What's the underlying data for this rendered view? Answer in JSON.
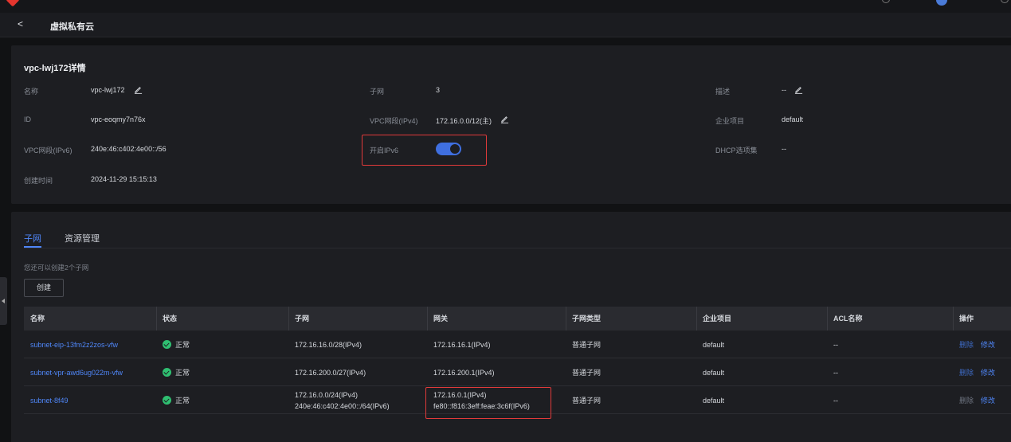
{
  "header": {
    "back_glyph": "<",
    "title": "虚拟私有云"
  },
  "detail": {
    "title": "vpc-lwj172详情",
    "fields": {
      "name_label": "名称",
      "name_value": "vpc-lwj172",
      "subnet_label": "子网",
      "subnet_value": "3",
      "desc_label": "描述",
      "desc_value": "--",
      "id_label": "ID",
      "id_value": "vpc-eoqmy7n76x",
      "ipv4_label": "VPC网段(IPv4)",
      "ipv4_value": "172.16.0.0/12(主)",
      "project_label": "企业项目",
      "project_value": "default",
      "ipv6_label": "VPC网段(IPv6)",
      "ipv6_value": "240e:46:c402:4e00::/56",
      "enable_ipv6_label": "开启IPv6",
      "enable_ipv6_on": true,
      "dhcp_label": "DHCP选项集",
      "dhcp_value": "--",
      "created_label": "创建时间",
      "created_value": "2024-11-29 15:15:13"
    }
  },
  "tabs": [
    "子网",
    "资源管理"
  ],
  "quota_text": "您还可以创建2个子网",
  "create_label": "创建",
  "table": {
    "columns": [
      "名称",
      "状态",
      "子网",
      "网关",
      "子网类型",
      "企业项目",
      "ACL名称",
      "操作"
    ],
    "rows": [
      {
        "name": "subnet-eip-13fm2z2zos-vfw",
        "status": "正常",
        "subnet": [
          "172.16.16.0/28(IPv4)"
        ],
        "gateway": [
          "172.16.16.1(IPv4)"
        ],
        "type": "普通子网",
        "project": "default",
        "acl": "--",
        "op_delete": "删除",
        "op_edit": "修改"
      },
      {
        "name": "subnet-vpr-awd6ug022m-vfw",
        "status": "正常",
        "subnet": [
          "172.16.200.0/27(IPv4)"
        ],
        "gateway": [
          "172.16.200.1(IPv4)"
        ],
        "type": "普通子网",
        "project": "default",
        "acl": "--",
        "op_delete": "删除",
        "op_edit": "修改"
      },
      {
        "name": "subnet-8f49",
        "status": "正常",
        "subnet": [
          "172.16.0.0/24(IPv4)",
          "240e:46:c402:4e00::/64(IPv6)"
        ],
        "gateway": [
          "172.16.0.1(IPv4)",
          "fe80::f816:3eff:feae:3c6f(IPv6)"
        ],
        "type": "普通子网",
        "project": "default",
        "acl": "--",
        "op_delete": "删除",
        "op_edit": "修改"
      }
    ]
  },
  "colors": {
    "accent": "#4f86f7",
    "success": "#2fbf71",
    "highlight": "#e03a3a",
    "toggle_on": "#3f6fe0"
  }
}
